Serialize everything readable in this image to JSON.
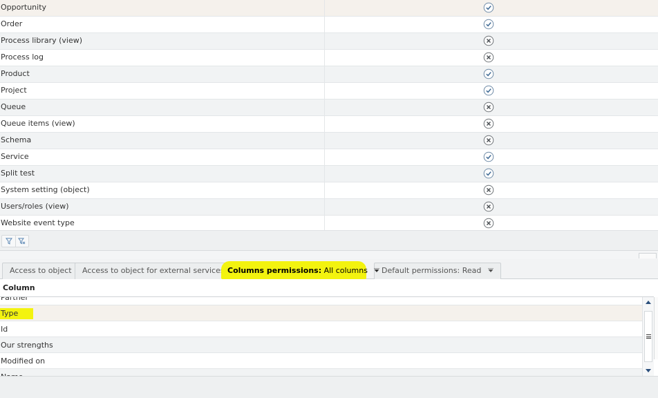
{
  "objects": [
    {
      "name": "Opportunity",
      "allowed": true
    },
    {
      "name": "Order",
      "allowed": true
    },
    {
      "name": "Process library (view)",
      "allowed": false
    },
    {
      "name": "Process log",
      "allowed": false
    },
    {
      "name": "Product",
      "allowed": true
    },
    {
      "name": "Project",
      "allowed": true
    },
    {
      "name": "Queue",
      "allowed": false
    },
    {
      "name": "Queue items (view)",
      "allowed": false
    },
    {
      "name": "Schema",
      "allowed": false
    },
    {
      "name": "Service",
      "allowed": true
    },
    {
      "name": "Split test",
      "allowed": true
    },
    {
      "name": "System setting (object)",
      "allowed": false
    },
    {
      "name": "Users/roles (view)",
      "allowed": false
    },
    {
      "name": "Website event type",
      "allowed": false
    }
  ],
  "filters": {
    "filter_icon": "filter-icon",
    "clear_filter_icon": "clear-filter-icon"
  },
  "tabs": {
    "access_to_object": "Access to object",
    "access_external": "Access to object for external services",
    "columns_permissions_label": "Columns permissions:",
    "columns_permissions_value": "All columns",
    "default_permissions_label": "Default permissions:",
    "default_permissions_value": "Read"
  },
  "columns": {
    "header": "Column",
    "items": [
      "Partner",
      "Type",
      "Id",
      "Our strengths",
      "Modified on",
      "Name"
    ]
  },
  "colors": {
    "allowed": "#4a7fb5",
    "denied": "#6b6f73",
    "highlight": "#f3f30f"
  }
}
